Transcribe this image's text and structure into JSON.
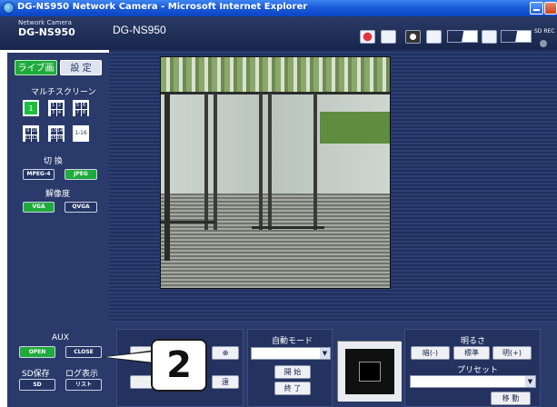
{
  "window": {
    "title": "DG-NS950 Network Camera - Microsoft Internet Explorer"
  },
  "header": {
    "brand_small": "Network Camera",
    "model": "DG-NS950",
    "model_center": "DG-NS950",
    "sd_rec": "SD REC"
  },
  "tabs": {
    "live": "ライブ画",
    "settings": "設 定"
  },
  "multiscreen": {
    "label": "マルチスクリーン",
    "one": "1",
    "grid_1234": [
      "1",
      "2",
      "3",
      "4"
    ],
    "grid_5678": [
      "5",
      "6",
      "7",
      "8"
    ],
    "grid_9_12": [
      "9",
      "10",
      "11",
      "12"
    ],
    "grid_13_16": [
      "13",
      "14",
      "15",
      "16"
    ],
    "grid_1_16": "1-16"
  },
  "switch": {
    "label": "切 換",
    "mpeg4": "MPEG-4",
    "jpeg": "JPEG"
  },
  "resolution": {
    "label": "解像度",
    "vga": "VGA",
    "qvga": "QVGA"
  },
  "aux": {
    "label": "AUX",
    "open": "OPEN",
    "close": "CLOSE"
  },
  "sd": {
    "save_label": "SD保存",
    "log_label": "ログ表示",
    "sd_button": "SD",
    "list_button": "リスト"
  },
  "zoom": {
    "zoom_in_icon": "zoom-in-icon",
    "far_label": "遠"
  },
  "auto_mode": {
    "label": "自動モード",
    "start": "開 始",
    "end": "終 了"
  },
  "brightness": {
    "label": "明るさ",
    "dark": "暗(-)",
    "standard": "標準",
    "bright": "明(+)"
  },
  "preset": {
    "label": "プリセット",
    "move": "移 動"
  },
  "callout": {
    "number": "2"
  }
}
